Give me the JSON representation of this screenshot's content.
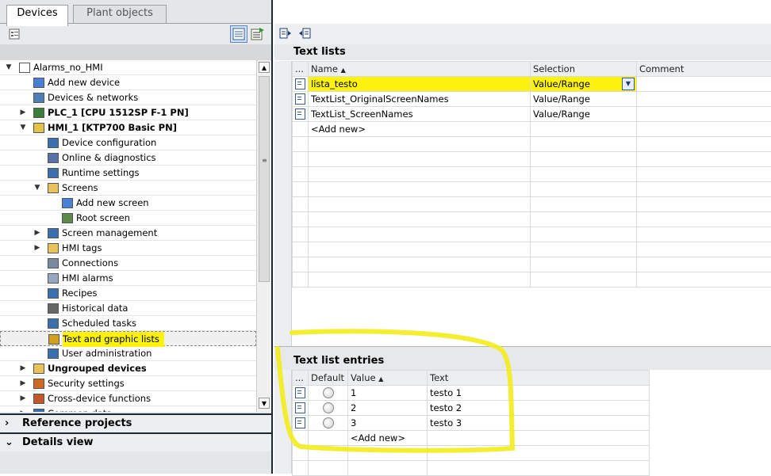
{
  "left_panel": {
    "tabs": [
      "Devices",
      "Plant objects"
    ],
    "tree": [
      {
        "label": "Alarms_no_HMI",
        "level": 0,
        "expander": "down",
        "icon": "file-icon"
      },
      {
        "label": "Add new device",
        "level": 1,
        "expander": "",
        "icon": "add-device-icon"
      },
      {
        "label": "Devices & networks",
        "level": 1,
        "expander": "",
        "icon": "network-icon"
      },
      {
        "label": "PLC_1 [CPU 1512SP F-1 PN]",
        "level": 1,
        "expander": "right",
        "icon": "plc-icon",
        "bold": true
      },
      {
        "label": "HMI_1 [KTP700 Basic PN]",
        "level": 1,
        "expander": "down",
        "icon": "hmi-icon",
        "bold": true
      },
      {
        "label": "Device configuration",
        "level": 2,
        "expander": "",
        "icon": "device-config-icon"
      },
      {
        "label": "Online & diagnostics",
        "level": 2,
        "expander": "",
        "icon": "diagnostics-icon"
      },
      {
        "label": "Runtime settings",
        "level": 2,
        "expander": "",
        "icon": "wrench-icon"
      },
      {
        "label": "Screens",
        "level": 2,
        "expander": "down",
        "icon": "folder-icon"
      },
      {
        "label": "Add new screen",
        "level": 3,
        "expander": "",
        "icon": "add-screen-icon"
      },
      {
        "label": "Root screen",
        "level": 3,
        "expander": "",
        "icon": "screen-icon"
      },
      {
        "label": "Screen management",
        "level": 2,
        "expander": "right",
        "icon": "screen-management-icon"
      },
      {
        "label": "HMI tags",
        "level": 2,
        "expander": "right",
        "icon": "tags-folder-icon"
      },
      {
        "label": "Connections",
        "level": 2,
        "expander": "",
        "icon": "connections-icon"
      },
      {
        "label": "HMI alarms",
        "level": 2,
        "expander": "",
        "icon": "alarm-envelope-icon"
      },
      {
        "label": "Recipes",
        "level": 2,
        "expander": "",
        "icon": "recipes-icon"
      },
      {
        "label": "Historical data",
        "level": 2,
        "expander": "",
        "icon": "historical-data-icon"
      },
      {
        "label": "Scheduled tasks",
        "level": 2,
        "expander": "",
        "icon": "scheduled-tasks-icon"
      },
      {
        "label": "Text and graphic lists",
        "level": 2,
        "expander": "",
        "icon": "text-lists-icon",
        "selected": true
      },
      {
        "label": "User administration",
        "level": 2,
        "expander": "",
        "icon": "users-icon"
      },
      {
        "label": "Ungrouped devices",
        "level": 1,
        "expander": "right",
        "icon": "ungrouped-devices-icon",
        "bold": true
      },
      {
        "label": "Security settings",
        "level": 1,
        "expander": "right",
        "icon": "security-icon"
      },
      {
        "label": "Cross-device functions",
        "level": 1,
        "expander": "right",
        "icon": "cross-device-icon"
      },
      {
        "label": "Common data",
        "level": 1,
        "expander": "right",
        "icon": "common-data-icon"
      }
    ],
    "reference_projects": "Reference projects",
    "details_view": "Details view"
  },
  "text_lists": {
    "title": "Text lists",
    "columns": [
      "...",
      "Name",
      "Selection",
      "Comment"
    ],
    "rows": [
      {
        "name": "lista_testo",
        "selection": "Value/Range",
        "comment": "",
        "selected": true
      },
      {
        "name": "TextList_OriginalScreenNames",
        "selection": "Value/Range",
        "comment": ""
      },
      {
        "name": "TextList_ScreenNames",
        "selection": "Value/Range",
        "comment": ""
      }
    ],
    "add_new": "<Add new>"
  },
  "text_list_entries": {
    "title": "Text list entries",
    "columns": [
      "...",
      "Default",
      "Value",
      "Text"
    ],
    "rows": [
      {
        "value": "1",
        "text": "testo 1"
      },
      {
        "value": "2",
        "text": "testo 2"
      },
      {
        "value": "3",
        "text": "testo 3"
      }
    ],
    "add_new": "<Add new>"
  },
  "colors": {
    "highlight": "#fdf20e",
    "panel_border": "#1c2833",
    "header_bg": "#eceef0"
  }
}
